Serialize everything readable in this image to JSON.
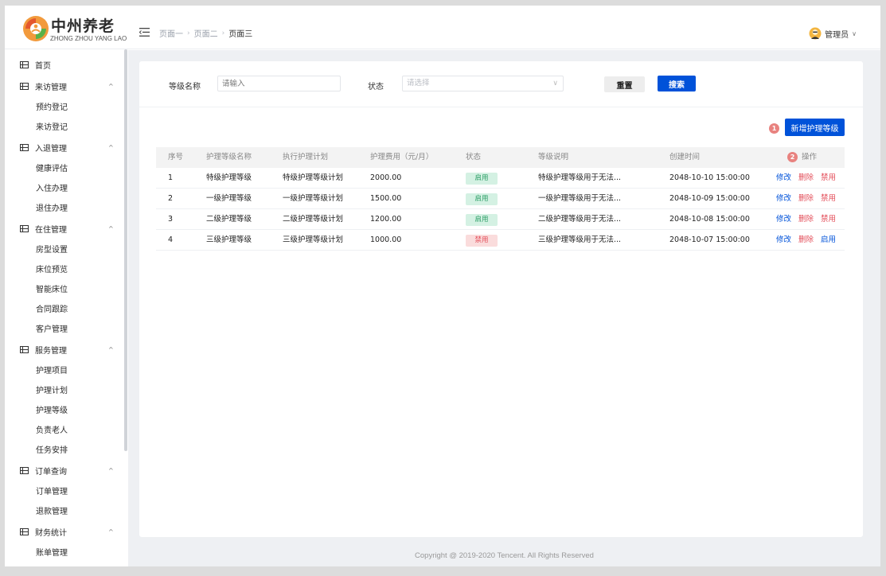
{
  "brand": {
    "title": "中州养老",
    "subtitle": "ZHONG ZHOU YANG LAO"
  },
  "breadcrumb": [
    "页面一",
    "页面二",
    "页面三"
  ],
  "user": {
    "name": "管理员"
  },
  "sidebar": {
    "groups": [
      {
        "label": "首页",
        "expandable": false,
        "items": []
      },
      {
        "label": "来访管理",
        "expandable": true,
        "items": [
          "预约登记",
          "来访登记"
        ]
      },
      {
        "label": "入退管理",
        "expandable": true,
        "items": [
          "健康评估",
          "入住办理",
          "退住办理"
        ]
      },
      {
        "label": "在住管理",
        "expandable": true,
        "items": [
          "房型设置",
          "床位预览",
          "智能床位",
          "合同跟踪",
          "客户管理"
        ]
      },
      {
        "label": "服务管理",
        "expandable": true,
        "items": [
          "护理项目",
          "护理计划",
          "护理等级",
          "负责老人",
          "任务安排"
        ]
      },
      {
        "label": "订单查询",
        "expandable": true,
        "items": [
          "订单管理",
          "退款管理"
        ]
      },
      {
        "label": "财务统计",
        "expandable": true,
        "items": [
          "账单管理"
        ]
      }
    ]
  },
  "filters": {
    "level_label": "等级名称",
    "level_placeholder": "请输入",
    "status_label": "状态",
    "status_placeholder": "请选择",
    "reset_label": "重置",
    "search_label": "搜索"
  },
  "markers": {
    "one": "1",
    "two": "2"
  },
  "add_button_label": "新增护理等级",
  "table": {
    "columns": [
      "序号",
      "护理等级名称",
      "执行护理计划",
      "护理费用（元/月）",
      "状态",
      "等级说明",
      "创建时间",
      "操作"
    ],
    "rows": [
      {
        "no": "1",
        "name": "特级护理等级",
        "plan": "特级护理等级计划",
        "fee": "2000.00",
        "status": "启用",
        "status_on": true,
        "desc": "特级护理等级用于无法...",
        "created": "2048-10-10 15:00:00",
        "ops": [
          "修改",
          "删除",
          "禁用"
        ]
      },
      {
        "no": "2",
        "name": "一级护理等级",
        "plan": "一级护理等级计划",
        "fee": "1500.00",
        "status": "启用",
        "status_on": true,
        "desc": "一级护理等级用于无法...",
        "created": "2048-10-09 15:00:00",
        "ops": [
          "修改",
          "删除",
          "禁用"
        ]
      },
      {
        "no": "3",
        "name": "二级护理等级",
        "plan": "二级护理等级计划",
        "fee": "1200.00",
        "status": "启用",
        "status_on": true,
        "desc": "二级护理等级用于无法...",
        "created": "2048-10-08 15:00:00",
        "ops": [
          "修改",
          "删除",
          "禁用"
        ]
      },
      {
        "no": "4",
        "name": "三级护理等级",
        "plan": "三级护理等级计划",
        "fee": "1000.00",
        "status": "禁用",
        "status_on": false,
        "desc": "三级护理等级用于无法...",
        "created": "2048-10-07 15:00:00",
        "ops": [
          "修改",
          "删除",
          "启用"
        ]
      }
    ]
  },
  "footer": "Copyright @ 2019-2020 Tencent. All Rights Reserved",
  "colors": {
    "primary": "#0052d9",
    "danger": "#e34d59",
    "success_bg": "#d4f1e3",
    "danger_bg": "#fadcdc"
  }
}
